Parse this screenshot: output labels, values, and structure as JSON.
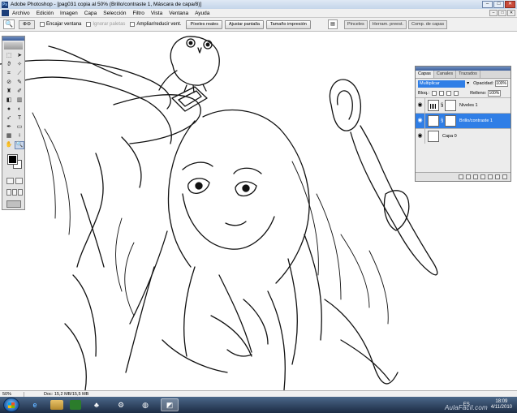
{
  "window": {
    "app_icon": "ps-icon",
    "title": "Adobe Photoshop - [pag031 copia al 50% (Brillo/contraste 1, Máscara de capa/8)]"
  },
  "menu": [
    "Archivo",
    "Edición",
    "Imagen",
    "Capa",
    "Selección",
    "Filtro",
    "Vista",
    "Ventana",
    "Ayuda"
  ],
  "options_bar": {
    "tool_icon": "zoom-icon",
    "resize_window": "Encajar ventana",
    "ignore_palettes": "Ignorar paletas",
    "zoom_resize": "Ampliar/reducir vent.",
    "btn_actual": "Píxeles reales",
    "btn_fit": "Ajustar pantalla",
    "btn_print": "Tamaño impresión"
  },
  "dock": {
    "tabs": [
      "Pinceles",
      "Herram. preest.",
      "Comp. de capas"
    ]
  },
  "layers_panel": {
    "tabs": [
      "Capas",
      "Canales",
      "Trazados"
    ],
    "active_tab": "Capas",
    "blend_mode": "Multiplicar",
    "opacity_label": "Opacidad:",
    "opacity": "100%",
    "lock_label": "Bloq.:",
    "fill_label": "Relleno:",
    "fill": "100%",
    "layers": [
      {
        "name": "Niveles 1",
        "selected": false
      },
      {
        "name": "Brillo/contraste 1",
        "selected": true
      },
      {
        "name": "Capa 0",
        "selected": false
      }
    ]
  },
  "status": {
    "zoom": "50%",
    "doc": "Doc: 15,2 MB/15,5 MB"
  },
  "taskbar": {
    "language": "ES",
    "time": "18:09",
    "date": "4/11/2010",
    "watermark": "AulaFacil.com"
  },
  "colors": {
    "selection_blue": "#2f7ee6",
    "panel_bg": "#ececec",
    "taskbar": "#1c2c44"
  }
}
